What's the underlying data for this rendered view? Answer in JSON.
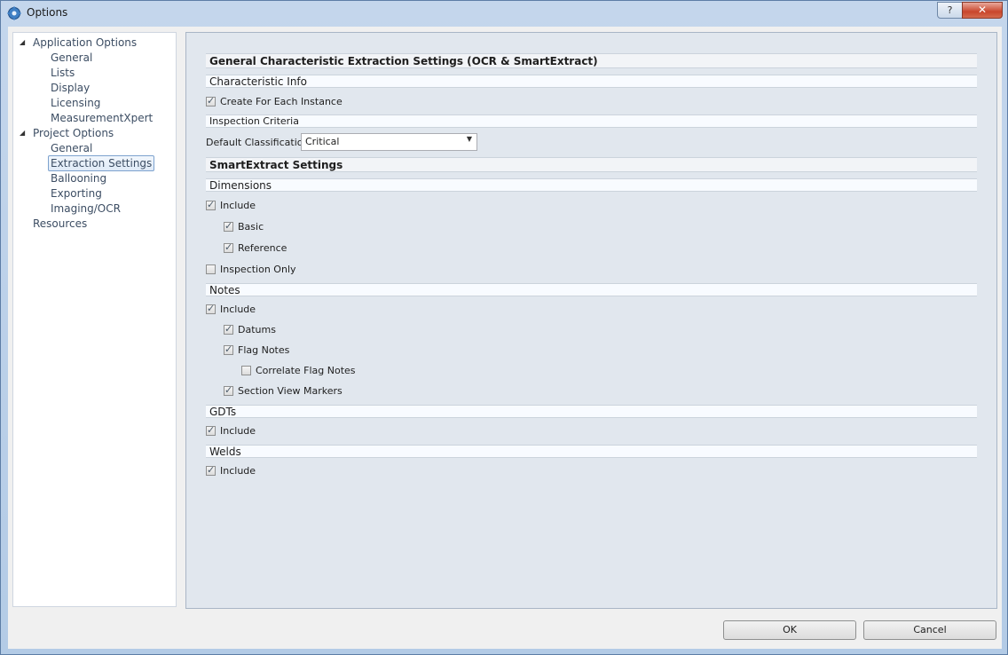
{
  "window": {
    "title": "Options",
    "help_label": "?",
    "close_label": "✕"
  },
  "tree": [
    {
      "label": "Application Options",
      "level": 0,
      "expanded": true
    },
    {
      "label": "General",
      "level": 1
    },
    {
      "label": "Lists",
      "level": 1
    },
    {
      "label": "Display",
      "level": 1
    },
    {
      "label": "Licensing",
      "level": 1
    },
    {
      "label": "MeasurementXpert",
      "level": 1
    },
    {
      "label": "Project Options",
      "level": 0,
      "expanded": true
    },
    {
      "label": "General",
      "level": 1
    },
    {
      "label": "Extraction Settings",
      "level": 1,
      "selected": true
    },
    {
      "label": "Ballooning",
      "level": 1
    },
    {
      "label": "Exporting",
      "level": 1
    },
    {
      "label": "Imaging/OCR",
      "level": 1
    },
    {
      "label": "Resources",
      "level": 0
    }
  ],
  "panel": {
    "general_header": "General Characteristic Extraction Settings (OCR & SmartExtract)",
    "characteristic_info": "Characteristic Info",
    "create_for_each_instance": {
      "label": "Create For Each Instance",
      "checked": true
    },
    "inspection_criteria": "Inspection Criteria",
    "default_classification": {
      "label": "Default Classification",
      "value": "Critical"
    },
    "smartextract_header": "SmartExtract Settings",
    "dimensions": {
      "header": "Dimensions",
      "include": {
        "label": "Include",
        "checked": true
      },
      "basic": {
        "label": "Basic",
        "checked": true
      },
      "reference": {
        "label": "Reference",
        "checked": true
      },
      "inspection_only": {
        "label": "Inspection Only",
        "checked": false
      }
    },
    "notes": {
      "header": "Notes",
      "include": {
        "label": "Include",
        "checked": true
      },
      "datums": {
        "label": "Datums",
        "checked": true
      },
      "flag_notes": {
        "label": "Flag Notes",
        "checked": true
      },
      "correlate_flag_notes": {
        "label": "Correlate Flag Notes",
        "checked": false
      },
      "section_view_markers": {
        "label": "Section View Markers",
        "checked": true
      }
    },
    "gdts": {
      "header": "GDTs",
      "include": {
        "label": "Include",
        "checked": true
      }
    },
    "welds": {
      "header": "Welds",
      "include": {
        "label": "Include",
        "checked": true
      }
    }
  },
  "footer": {
    "ok_label": "OK",
    "cancel_label": "Cancel"
  }
}
